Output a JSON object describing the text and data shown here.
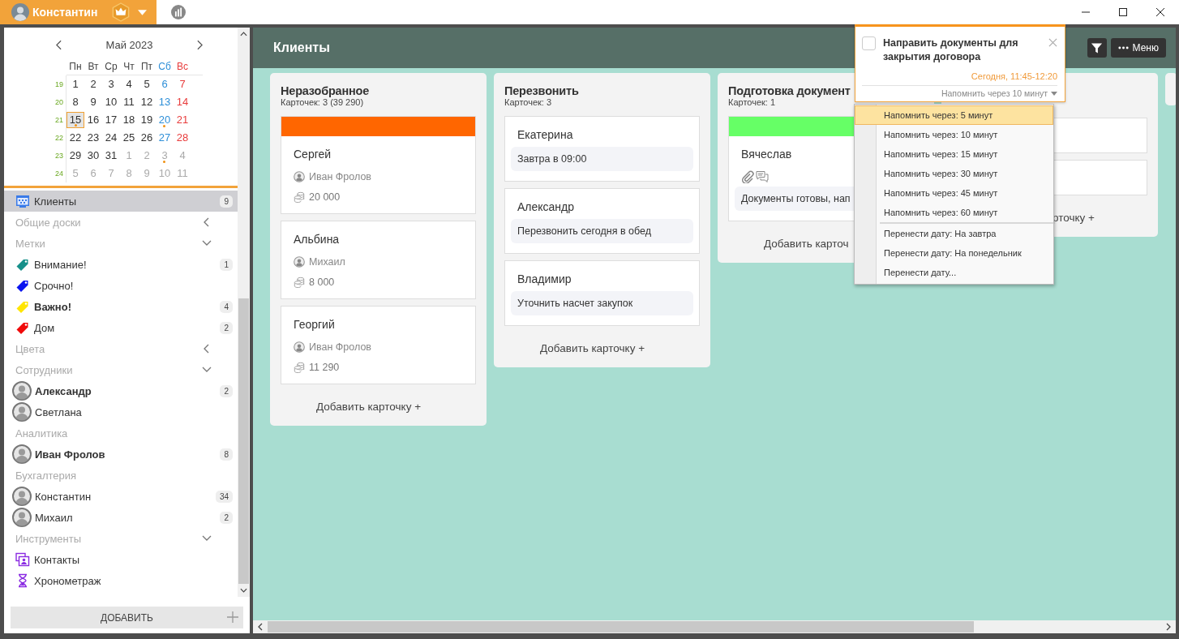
{
  "user_menu": {
    "name": "Константин"
  },
  "calendar": {
    "month": "Май 2023",
    "weekdays": [
      {
        "label": "Пн",
        "kind": "weekday"
      },
      {
        "label": "Вт",
        "kind": "weekday"
      },
      {
        "label": "Ср",
        "kind": "weekday"
      },
      {
        "label": "Чт",
        "kind": "weekday"
      },
      {
        "label": "Пт",
        "kind": "weekday"
      },
      {
        "label": "Сб",
        "kind": "saturday"
      },
      {
        "label": "Вс",
        "kind": "sunday"
      }
    ],
    "weeks": [
      {
        "number": "19",
        "days": [
          {
            "label": "1",
            "other_month": false,
            "selected": false,
            "marked": false
          },
          {
            "label": "2",
            "other_month": false,
            "selected": false,
            "marked": false
          },
          {
            "label": "3",
            "other_month": false,
            "selected": false,
            "marked": false
          },
          {
            "label": "4",
            "other_month": false,
            "selected": false,
            "marked": false
          },
          {
            "label": "5",
            "other_month": false,
            "selected": false,
            "marked": false
          },
          {
            "label": "6",
            "other_month": false,
            "selected": false,
            "marked": false
          },
          {
            "label": "7",
            "other_month": false,
            "selected": false,
            "marked": false
          }
        ]
      },
      {
        "number": "20",
        "days": [
          {
            "label": "8",
            "other_month": false,
            "selected": false,
            "marked": false
          },
          {
            "label": "9",
            "other_month": false,
            "selected": false,
            "marked": false
          },
          {
            "label": "10",
            "other_month": false,
            "selected": false,
            "marked": false
          },
          {
            "label": "11",
            "other_month": false,
            "selected": false,
            "marked": false
          },
          {
            "label": "12",
            "other_month": false,
            "selected": false,
            "marked": false
          },
          {
            "label": "13",
            "other_month": false,
            "selected": false,
            "marked": false
          },
          {
            "label": "14",
            "other_month": false,
            "selected": false,
            "marked": false
          }
        ]
      },
      {
        "number": "21",
        "days": [
          {
            "label": "15",
            "other_month": false,
            "selected": true,
            "marked": true
          },
          {
            "label": "16",
            "other_month": false,
            "selected": false,
            "marked": false
          },
          {
            "label": "17",
            "other_month": false,
            "selected": false,
            "marked": false
          },
          {
            "label": "18",
            "other_month": false,
            "selected": false,
            "marked": false
          },
          {
            "label": "19",
            "other_month": false,
            "selected": false,
            "marked": false
          },
          {
            "label": "20",
            "other_month": false,
            "selected": false,
            "marked": true
          },
          {
            "label": "21",
            "other_month": false,
            "selected": false,
            "marked": false
          }
        ]
      },
      {
        "number": "22",
        "days": [
          {
            "label": "22",
            "other_month": false,
            "selected": false,
            "marked": false
          },
          {
            "label": "23",
            "other_month": false,
            "selected": false,
            "marked": false
          },
          {
            "label": "24",
            "other_month": false,
            "selected": false,
            "marked": false
          },
          {
            "label": "25",
            "other_month": false,
            "selected": false,
            "marked": false
          },
          {
            "label": "26",
            "other_month": false,
            "selected": false,
            "marked": false
          },
          {
            "label": "27",
            "other_month": false,
            "selected": false,
            "marked": false
          },
          {
            "label": "28",
            "other_month": false,
            "selected": false,
            "marked": false
          }
        ]
      },
      {
        "number": "23",
        "days": [
          {
            "label": "29",
            "other_month": false,
            "selected": false,
            "marked": false
          },
          {
            "label": "30",
            "other_month": false,
            "selected": false,
            "marked": false
          },
          {
            "label": "31",
            "other_month": false,
            "selected": false,
            "marked": false
          },
          {
            "label": "1",
            "other_month": true,
            "selected": false,
            "marked": false
          },
          {
            "label": "2",
            "other_month": true,
            "selected": false,
            "marked": false
          },
          {
            "label": "3",
            "other_month": true,
            "selected": false,
            "marked": true
          },
          {
            "label": "4",
            "other_month": true,
            "selected": false,
            "marked": false
          }
        ]
      },
      {
        "number": "24",
        "days": [
          {
            "label": "5",
            "other_month": true,
            "selected": false,
            "marked": false
          },
          {
            "label": "6",
            "other_month": true,
            "selected": false,
            "marked": false
          },
          {
            "label": "7",
            "other_month": true,
            "selected": false,
            "marked": false
          },
          {
            "label": "8",
            "other_month": true,
            "selected": false,
            "marked": false
          },
          {
            "label": "9",
            "other_month": true,
            "selected": false,
            "marked": false
          },
          {
            "label": "10",
            "other_month": true,
            "selected": false,
            "marked": false
          },
          {
            "label": "11",
            "other_month": true,
            "selected": false,
            "marked": false
          }
        ]
      }
    ]
  },
  "sidebar": {
    "items": [
      {
        "kind": "board",
        "label": "Клиенты",
        "count": "9",
        "selected": true,
        "bold": false
      },
      {
        "kind": "section",
        "label": "Общие доски",
        "expanded": false
      },
      {
        "kind": "section",
        "label": "Метки",
        "expanded": true
      },
      {
        "kind": "tag",
        "label": "Внимание!",
        "color": "#16908a",
        "count": "1",
        "selected": false,
        "bold": false
      },
      {
        "kind": "tag",
        "label": "Срочно!",
        "color": "#0a14f0",
        "selected": false,
        "bold": false
      },
      {
        "kind": "tag",
        "label": "Важно!",
        "color": "#ffe500",
        "count": "4",
        "selected": false,
        "bold": true
      },
      {
        "kind": "tag",
        "label": "Дом",
        "color": "#f00a0a",
        "count": "2",
        "selected": false,
        "bold": false
      },
      {
        "kind": "section",
        "label": "Цвета",
        "expanded": false
      },
      {
        "kind": "section",
        "label": "Сотрудники",
        "expanded": true
      },
      {
        "kind": "person",
        "label": "Александр",
        "count": "2",
        "selected": false,
        "bold": true
      },
      {
        "kind": "person",
        "label": "Светлана",
        "selected": false,
        "bold": false
      },
      {
        "kind": "group",
        "label": "Аналитика"
      },
      {
        "kind": "person",
        "label": "Иван Фролов",
        "count": "8",
        "selected": false,
        "bold": true
      },
      {
        "kind": "group",
        "label": "Бухгалтерия"
      },
      {
        "kind": "person",
        "label": "Константин",
        "count": "34",
        "selected": false,
        "bold": false
      },
      {
        "kind": "person",
        "label": "Михаил",
        "count": "2",
        "selected": false,
        "bold": false
      },
      {
        "kind": "section",
        "label": "Инструменты",
        "expanded": true
      },
      {
        "kind": "contacts",
        "label": "Контакты",
        "selected": false,
        "bold": false
      },
      {
        "kind": "timer",
        "label": "Хронометраж",
        "selected": false,
        "bold": false
      }
    ],
    "add_button": "ДОБАВИТЬ"
  },
  "board": {
    "title": "Клиенты",
    "menu_button": "Меню",
    "columns": [
      {
        "title": "Неразобранное",
        "count": "Карточек: 3 (39 290)",
        "add_label": "Добавить карточку +",
        "cards": [
          {
            "kind": "deal",
            "title": "Сергей",
            "color": "#ff6600",
            "assignee": "Иван Фролов",
            "amount": "20 000"
          },
          {
            "kind": "deal",
            "title": "Альбина",
            "assignee": "Михаил",
            "amount": "8 000"
          },
          {
            "kind": "deal",
            "title": "Георгий",
            "assignee": "Иван Фролов",
            "amount": "11 290"
          }
        ]
      },
      {
        "title": "Перезвонить",
        "count": "Карточек: 3",
        "add_label": "Добавить карточку +",
        "cards": [
          {
            "kind": "task",
            "title": "Екатерина",
            "note": "Завтра в 09:00"
          },
          {
            "kind": "task",
            "title": "Александр",
            "note": "Перезвонить сегодня в обед"
          },
          {
            "kind": "task",
            "title": "Владимир",
            "note": "Уточнить насчет закупок"
          }
        ]
      },
      {
        "title": "Подготовка документ",
        "count": "Карточек: 1",
        "add_label": "Добавить карточ",
        "cards": [
          {
            "kind": "task",
            "title": "Вячеслав",
            "color": "#66ff66",
            "attachments": true,
            "note": "Документы готовы, нап"
          }
        ]
      },
      {
        "add_label": "рточку +",
        "cards": [
          {
            "kind": "blank"
          },
          {
            "kind": "blank"
          }
        ]
      }
    ]
  },
  "reminder": {
    "title": "Направить документы для закрытия договора",
    "checked": false,
    "time": "Сегодня, 11:45-12:20",
    "remind": "Напомнить через 10 минут",
    "menu": {
      "groups": [
        {
          "items": [
            {
              "label": "Напомнить через: 5 минут",
              "selected": true
            },
            {
              "label": "Напомнить через: 10 минут",
              "selected": false
            },
            {
              "label": "Напомнить через: 15 минут",
              "selected": false
            },
            {
              "label": "Напомнить через: 30 минут",
              "selected": false
            },
            {
              "label": "Напомнить через: 45 минут",
              "selected": false
            },
            {
              "label": "Напомнить через: 60 минут",
              "selected": false
            }
          ]
        },
        {
          "items": [
            {
              "label": "Перенести дату: На завтра",
              "selected": false
            },
            {
              "label": "Перенести дату: На понедельник",
              "selected": false
            },
            {
              "label": "Перенести дату...",
              "selected": false
            }
          ]
        }
      ]
    }
  }
}
